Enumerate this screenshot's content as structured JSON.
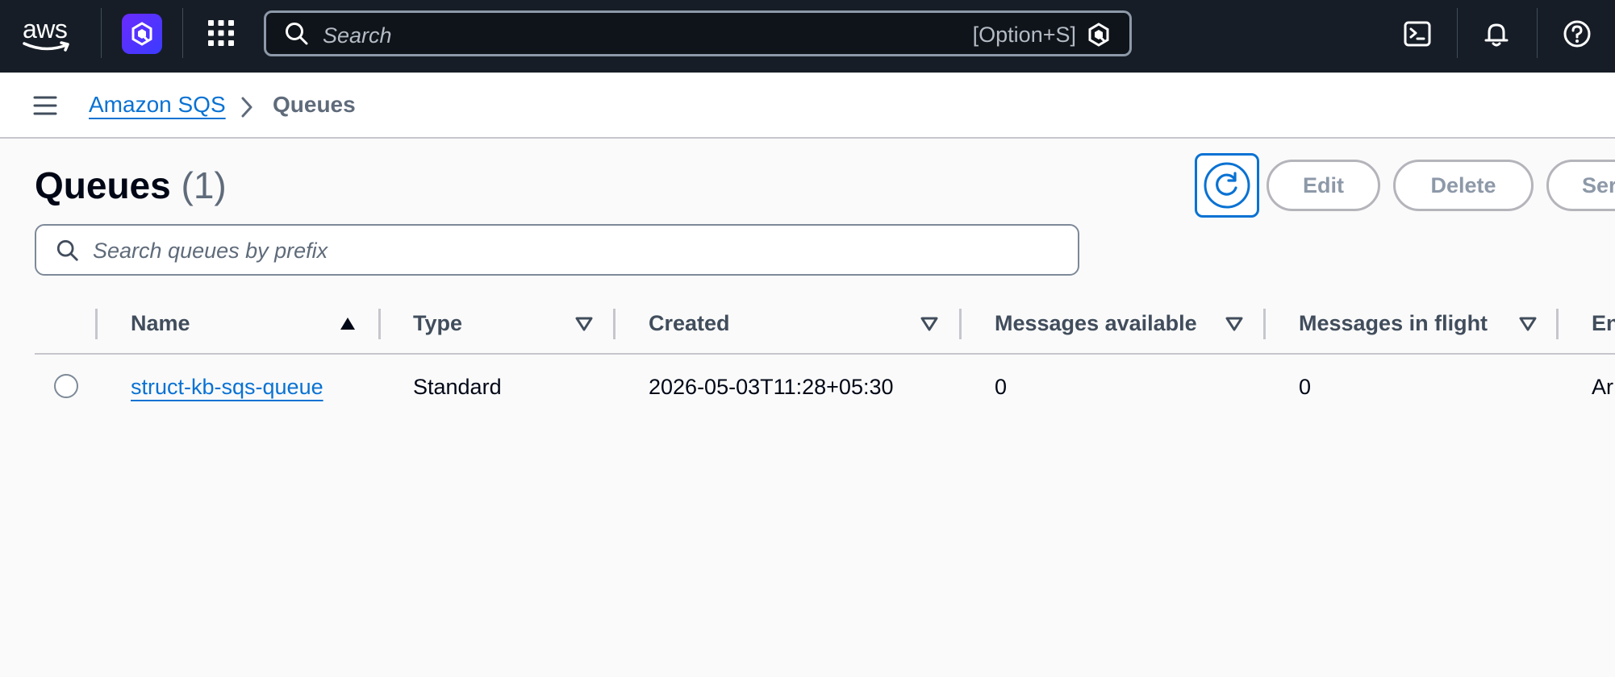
{
  "topnav": {
    "logo_text": "aws",
    "search_placeholder": "Search",
    "search_shortcut": "[Option+S]",
    "icons": [
      "aws-logo-icon",
      "q-assistant-icon",
      "apps-grid-icon",
      "search-icon",
      "cloudshell-icon",
      "bell-icon",
      "help-icon"
    ]
  },
  "breadcrumb": {
    "service": "Amazon SQS",
    "current": "Queues"
  },
  "page": {
    "title": "Queues",
    "count": "(1)",
    "buttons": {
      "edit": "Edit",
      "delete": "Delete",
      "send": "Ser"
    },
    "search_placeholder": "Search queues by prefix"
  },
  "table": {
    "columns": [
      "Name",
      "Type",
      "Created",
      "Messages available",
      "Messages in flight",
      "En"
    ],
    "sort": {
      "column": "Name",
      "direction": "ascending"
    },
    "rows": [
      {
        "name": "struct-kb-sqs-queue",
        "type": "Standard",
        "created": "2026-05-03T11:28+05:30",
        "messages_available": "0",
        "messages_in_flight": "0",
        "encryption": "Ar"
      }
    ]
  },
  "colors": {
    "nav_bg": "#161d26",
    "link": "#0972d3",
    "page_bg": "#fafafa",
    "disabled_text": "#8d99a8"
  }
}
